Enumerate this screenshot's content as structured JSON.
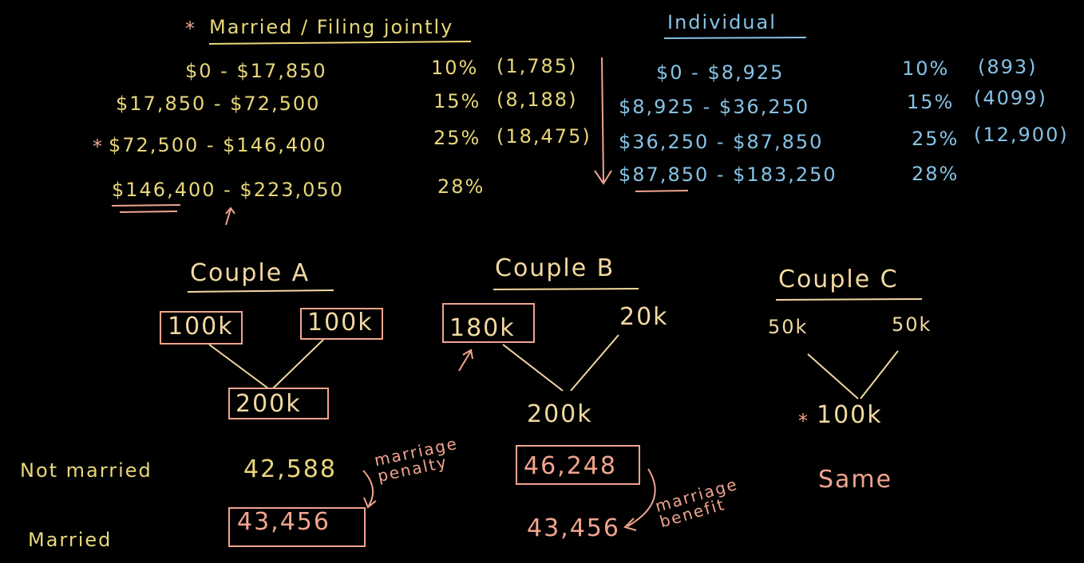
{
  "married": {
    "star": "*",
    "title": "Married / Filing jointly",
    "brackets": [
      {
        "range": "$0 - $17,850",
        "rate": "10%",
        "tax": "(1,785)"
      },
      {
        "range": "$17,850 - $72,500",
        "rate": "15%",
        "tax": "(8,188)"
      },
      {
        "range": "$72,500 - $146,400",
        "rate": "25%",
        "tax": "(18,475)",
        "star": "*"
      },
      {
        "range": "$146,400 - $223,050",
        "rate": "28%",
        "tax": ""
      }
    ]
  },
  "individual": {
    "title": "Individual",
    "brackets": [
      {
        "range": "$0 - $8,925",
        "rate": "10%",
        "tax": "(893)"
      },
      {
        "range": "$8,925 - $36,250",
        "rate": "15%",
        "tax": "(4099)"
      },
      {
        "range": "$36,250 - $87,850",
        "rate": "25%",
        "tax": "(12,900)"
      },
      {
        "range": "$87,850 - $183,250",
        "rate": "28%",
        "tax": ""
      }
    ]
  },
  "couples": [
    {
      "title": "Couple A",
      "inc1": "100k",
      "inc2": "100k",
      "total": "200k"
    },
    {
      "title": "Couple B",
      "inc1": "180k",
      "inc2": "20k",
      "total": "200k"
    },
    {
      "title": "Couple C",
      "inc1": "50k",
      "inc2": "50k",
      "total": "100k",
      "star": "*"
    }
  ],
  "rows": {
    "not_married": "Not married",
    "married": "Married"
  },
  "results": {
    "a_not_married": "42,588",
    "a_married": "43,456",
    "a_note": "marriage penalty",
    "b_not_married": "46,248",
    "b_married": "43,456",
    "b_note": "marriage benefit",
    "c_note": "Same"
  },
  "colors": {
    "yellow": "#e9d77a",
    "blue": "#86c3e6",
    "pink": "#f1a48e",
    "cream": "#f3d9a0"
  }
}
